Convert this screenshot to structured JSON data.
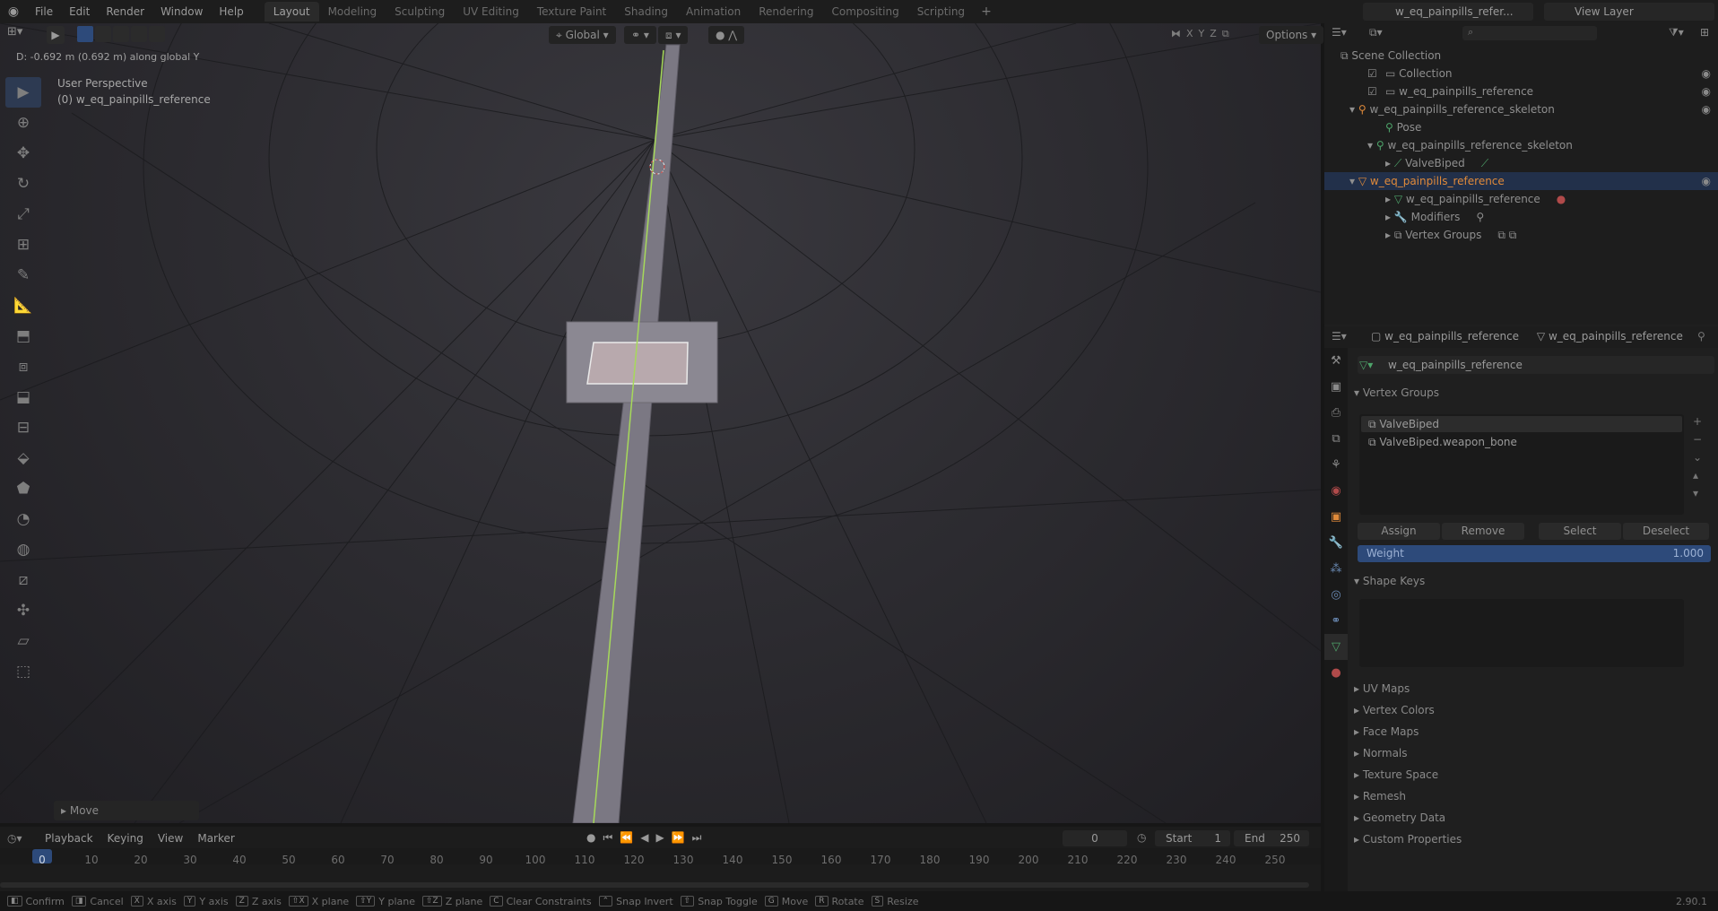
{
  "topbar": {
    "menus": [
      "File",
      "Edit",
      "Render",
      "Window",
      "Help"
    ],
    "workspaces": [
      "Layout",
      "Modeling",
      "Sculpting",
      "UV Editing",
      "Texture Paint",
      "Shading",
      "Animation",
      "Rendering",
      "Compositing",
      "Scripting"
    ],
    "active_workspace": "Layout",
    "scene": "w_eq_painpills_refer...",
    "view_layer": "View Layer"
  },
  "viewport": {
    "header_info": "D: -0.692 m (0.692 m) along global Y",
    "orientation": "Global",
    "options_label": "Options",
    "axis_x": "X",
    "axis_y": "Y",
    "axis_z": "Z",
    "overlay_view": "User Perspective",
    "overlay_object": "(0) w_eq_painpills_reference",
    "last_operator": "Move"
  },
  "outliner": {
    "search_placeholder": "",
    "rows": [
      {
        "label": "Scene Collection"
      },
      {
        "label": "Collection"
      },
      {
        "label": "w_eq_painpills_reference"
      },
      {
        "label": "w_eq_painpills_reference_skeleton"
      },
      {
        "label": "Pose"
      },
      {
        "label": "w_eq_painpills_reference_skeleton"
      },
      {
        "label": "ValveBiped"
      },
      {
        "label": "w_eq_painpills_reference"
      },
      {
        "label": "w_eq_painpills_reference"
      },
      {
        "label": "Modifiers"
      },
      {
        "label": "Vertex Groups"
      }
    ]
  },
  "properties": {
    "breadcrumb_object": "w_eq_painpills_reference",
    "breadcrumb_data": "w_eq_painpills_reference",
    "mesh_name": "w_eq_painpills_reference",
    "vertex_groups_title": "Vertex Groups",
    "vertex_groups": [
      "ValveBiped",
      "ValveBiped.weapon_bone"
    ],
    "assign": "Assign",
    "remove": "Remove",
    "select": "Select",
    "deselect": "Deselect",
    "weight_label": "Weight",
    "weight_value": "1.000",
    "shape_keys_title": "Shape Keys",
    "collapsed_panels": [
      "UV Maps",
      "Vertex Colors",
      "Face Maps",
      "Normals",
      "Texture Space",
      "Remesh",
      "Geometry Data",
      "Custom Properties"
    ]
  },
  "timeline": {
    "menus": [
      "Playback",
      "Keying",
      "View",
      "Marker"
    ],
    "current_frame": "0",
    "start_label": "Start",
    "start_value": "1",
    "end_label": "End",
    "end_value": "250",
    "ticks": [
      "0",
      "10",
      "20",
      "30",
      "40",
      "50",
      "60",
      "70",
      "80",
      "90",
      "100",
      "110",
      "120",
      "130",
      "140",
      "150",
      "160",
      "170",
      "180",
      "190",
      "200",
      "210",
      "220",
      "230",
      "240",
      "250"
    ]
  },
  "statusbar": {
    "items": [
      {
        "key": "",
        "label": "Confirm"
      },
      {
        "key": "",
        "label": "Cancel"
      },
      {
        "key": "X",
        "label": "X axis"
      },
      {
        "key": "Y",
        "label": "Y axis"
      },
      {
        "key": "Z",
        "label": "Z axis"
      },
      {
        "key": "⇧X",
        "label": "X plane"
      },
      {
        "key": "⇧Y",
        "label": "Y plane"
      },
      {
        "key": "⇧Z",
        "label": "Z plane"
      },
      {
        "key": "C",
        "label": "Clear Constraints"
      },
      {
        "key": "",
        "label": "Snap Invert"
      },
      {
        "key": "⇧",
        "label": "Snap Toggle"
      },
      {
        "key": "G",
        "label": "Move"
      },
      {
        "key": "R",
        "label": "Rotate"
      },
      {
        "key": "S",
        "label": "Resize"
      }
    ],
    "version": "2.90.1"
  },
  "colors": {
    "accent_blue": "#2d4a7a",
    "selection_orange": "#e87d0d",
    "axis_green": "#8fd04a"
  }
}
